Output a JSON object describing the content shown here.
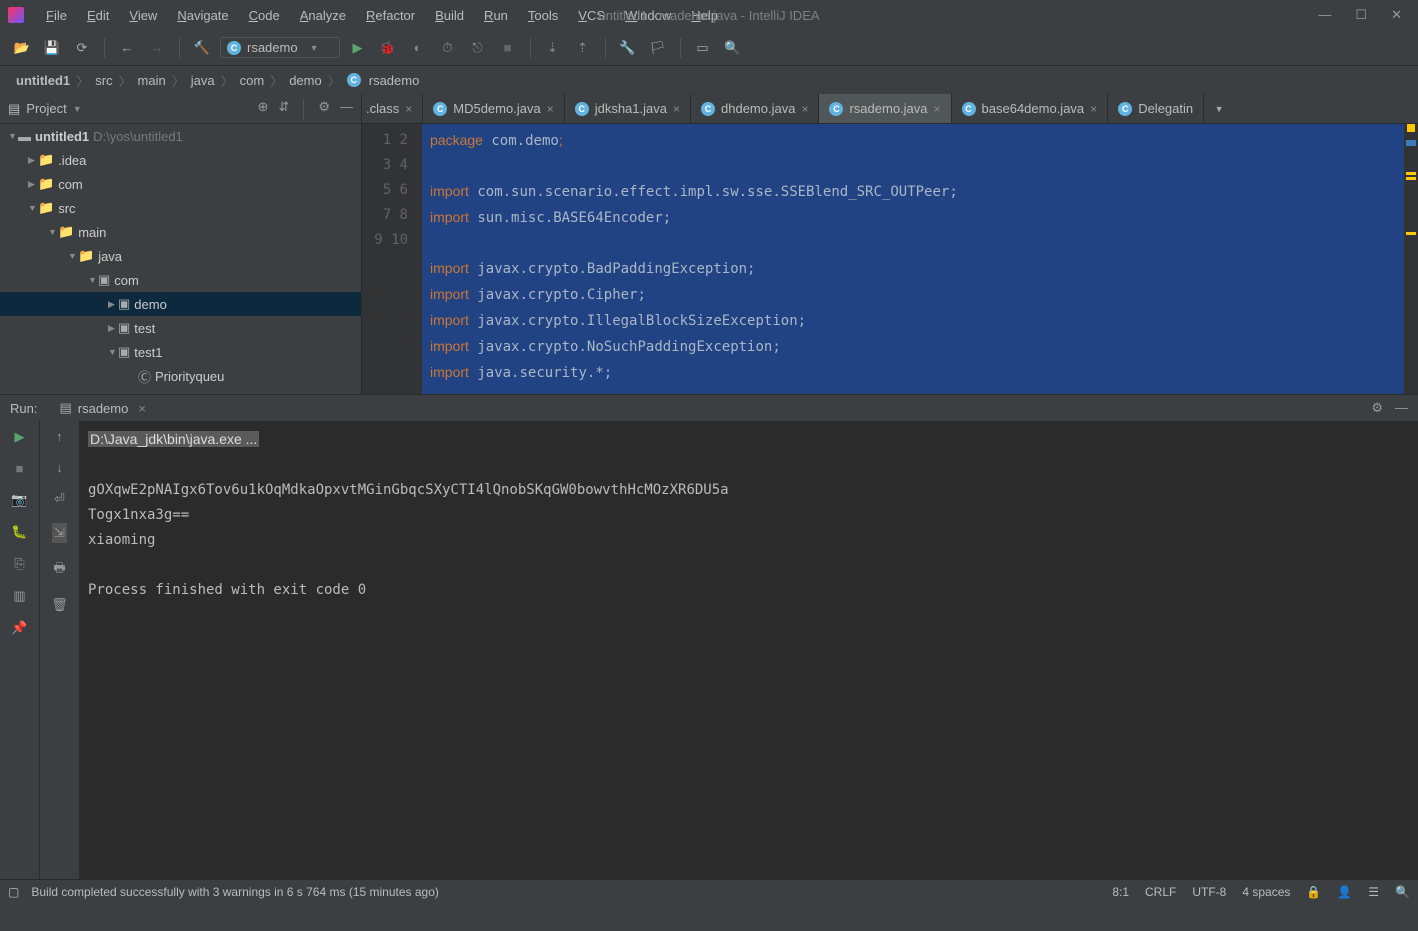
{
  "window": {
    "title": "untitled1 - rsademo.java - IntelliJ IDEA"
  },
  "menu": [
    "File",
    "Edit",
    "View",
    "Navigate",
    "Code",
    "Analyze",
    "Refactor",
    "Build",
    "Run",
    "Tools",
    "VCS",
    "Window",
    "Help"
  ],
  "run_config": "rsademo",
  "breadcrumbs": [
    "untitled1",
    "src",
    "main",
    "java",
    "com",
    "demo",
    "rsademo"
  ],
  "project": {
    "title": "Project",
    "root": {
      "name": "untitled1",
      "path": "D:\\yos\\untitled1"
    },
    "tree": [
      {
        "indent": 1,
        "arrow": "▶",
        "icon": "folder",
        "label": ".idea"
      },
      {
        "indent": 1,
        "arrow": "▶",
        "icon": "folder",
        "label": "com"
      },
      {
        "indent": 1,
        "arrow": "▼",
        "icon": "folder",
        "label": "src"
      },
      {
        "indent": 2,
        "arrow": "▼",
        "icon": "folder",
        "label": "main"
      },
      {
        "indent": 3,
        "arrow": "▼",
        "icon": "folder-blue",
        "label": "java"
      },
      {
        "indent": 4,
        "arrow": "▼",
        "icon": "pkg",
        "label": "com"
      },
      {
        "indent": 5,
        "arrow": "▶",
        "icon": "pkg",
        "label": "demo",
        "selected": true
      },
      {
        "indent": 5,
        "arrow": "▶",
        "icon": "pkg",
        "label": "test"
      },
      {
        "indent": 5,
        "arrow": "▼",
        "icon": "pkg",
        "label": "test1"
      },
      {
        "indent": 6,
        "arrow": "",
        "icon": "class",
        "label": "Priorityqueu"
      }
    ]
  },
  "tabs": [
    {
      "label": ".class",
      "type": "none",
      "active": false,
      "partial": true
    },
    {
      "label": "MD5demo.java",
      "type": "java",
      "active": false
    },
    {
      "label": "jdksha1.java",
      "type": "java",
      "active": false
    },
    {
      "label": "dhdemo.java",
      "type": "java",
      "active": false
    },
    {
      "label": "rsademo.java",
      "type": "java",
      "active": true
    },
    {
      "label": "base64demo.java",
      "type": "java",
      "active": false
    },
    {
      "label": "Delegatin",
      "type": "class",
      "active": false,
      "nocclose": true
    }
  ],
  "code": {
    "lines": [
      {
        "n": 1,
        "html": "<span class='kw'>package</span> com.demo<span class='semi'>;</span>"
      },
      {
        "n": 2,
        "html": ""
      },
      {
        "n": 3,
        "html": "<span class='kw'>import</span> com.sun.scenario.effect.impl.sw.sse.SSEBlend_SRC_OUTPeer;"
      },
      {
        "n": 4,
        "html": "<span class='kw'>import</span> sun.misc.BASE64Encoder;"
      },
      {
        "n": 5,
        "html": ""
      },
      {
        "n": 6,
        "html": "<span class='kw'>import</span> javax.crypto.BadPaddingException;"
      },
      {
        "n": 7,
        "html": "<span class='kw'>import</span> javax.crypto.Cipher;"
      },
      {
        "n": 8,
        "html": "<span class='kw'>import</span> javax.crypto.IllegalBlockSizeException;"
      },
      {
        "n": 9,
        "html": "<span class='kw'>import</span> javax.crypto.NoSuchPaddingException;"
      },
      {
        "n": 10,
        "html": "<span class='kw'>import</span> java.security.*;"
      }
    ]
  },
  "run": {
    "label": "Run:",
    "tab": "rsademo",
    "output": [
      {
        "t": "D:\\Java_jdk\\bin\\java.exe ...",
        "hl": true
      },
      {
        "t": ""
      },
      {
        "t": "gOXqwE2pNAIgx6Tov6u1kOqMdkaOpxvtMGinGbqcSXyCTI4lQnobSKqGW0bowvthHcMOzXR6DU5a"
      },
      {
        "t": "Togx1nxa3g=="
      },
      {
        "t": "xiaoming"
      },
      {
        "t": ""
      },
      {
        "t": "Process finished with exit code 0"
      }
    ]
  },
  "status": {
    "msg": "Build completed successfully with 3 warnings in 6 s 764 ms (15 minutes ago)",
    "pos": "8:1",
    "eol": "CRLF",
    "enc": "UTF-8",
    "indent": "4 spaces"
  }
}
